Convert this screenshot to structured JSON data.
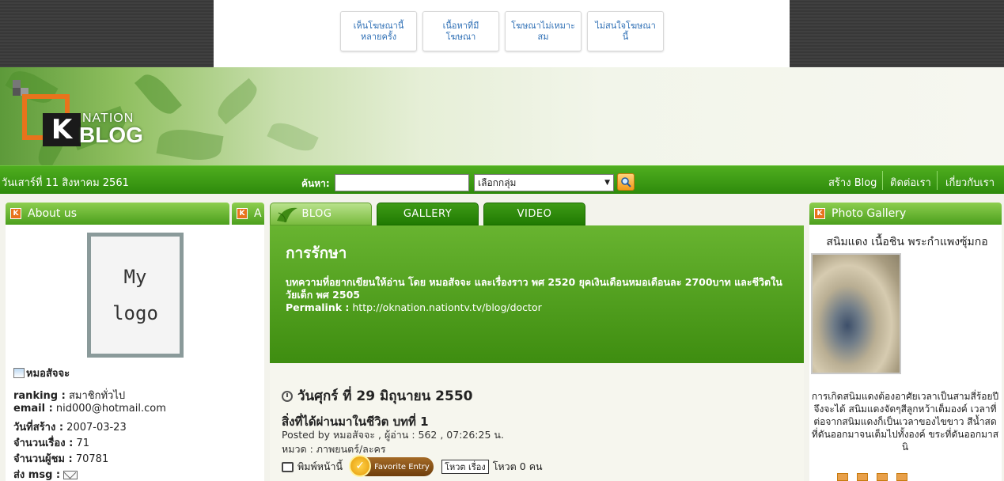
{
  "ad_options": [
    "เห็นโฆษณานี้หลายครั้ง",
    "เนื้อหาที่มีโฆษณา",
    "โฆษณาไม่เหมาะสม",
    "ไม่สนใจโฆษณานี้"
  ],
  "logo": {
    "nation": "NATION",
    "blog": "BLOG",
    "k": "K"
  },
  "nav": {
    "date": "วันเสาร์ที่ 11 สิงหาคม 2561",
    "search_label": "ค้นหา:",
    "search_value": "",
    "group_select": "เลือกกลุ่ม",
    "links": [
      "สร้าง Blog",
      "ติดต่อเรา",
      "เกี่ยวกับเรา"
    ]
  },
  "left_panel": {
    "title": "About us",
    "title2": "A",
    "logo_text": [
      "My",
      "logo"
    ],
    "username": "หมอสัจจะ",
    "stats": [
      {
        "label": "ranking :",
        "value": " สมาชิกทั่วไป"
      },
      {
        "label": "email :",
        "value": " nid000@hotmail.com"
      },
      {
        "label": "วันที่สร้าง :",
        "value": " 2007-03-23"
      },
      {
        "label": "จำนวนเรื่อง :",
        "value": " 71"
      },
      {
        "label": "จำนวนผู้ชม :",
        "value": " 70781"
      },
      {
        "label": "ส่ง msg :",
        "value": ""
      }
    ]
  },
  "tabs": [
    "BLOG",
    "GALLERY",
    "VIDEO"
  ],
  "blog": {
    "title": "การรักษา",
    "description": "บทความที่อยากเขียนให้อ่าน โดย หมอสัจจะ และเรื่องราว พศ 2520 ยุคเงินเดือนหมอเดือนละ 2700บาท และชีวิตในวัยเด็ก พศ 2505",
    "permalink_label": "Permalink :",
    "permalink_url": " http://oknation.nationtv.tv/blog/doctor"
  },
  "entry": {
    "date": "วันศุกร์ ที่ 29 มิถุนายน 2550",
    "title": "สิ่งที่ได้ผ่านมาในชีวิต บทที่ 1",
    "meta": "Posted by หมอสัจจะ , ผู้อ่าน : 562 , 07:26:25 น.",
    "category": "หมวด : ภาพยนตร์/ละคร",
    "print_label": "พิมพ์หน้านี้",
    "favorite_label": "Favorite Entry",
    "vote_button": "โหวต เรื่อง",
    "vote_count": "โหวต 0 คน"
  },
  "right_panel": {
    "title": "Photo Gallery",
    "photo_title": "สนิมแดง เนื้อชิน พระกำแพงซุ้มกอ",
    "caption": "การเกิดสนิมแดงต้องอาศัยเวลาเป็นสามสี่ร้อยปี จึงจะได้ สนิมแดงจัดๆสีลูกหว้าเต็มองค์ เวลาที่ต่อจากสนิมแดงก็เป็นเวลาของไขขาว สีน้ำสด ที่ดันออกมาจนเต็มไปทั้งองค์ ขระที่ดันออกมาสนิ"
  },
  "colors": {
    "nav_green": "#2e8a0c",
    "logo_orange": "#e8731c",
    "link_blue": "#2e6fb5"
  }
}
